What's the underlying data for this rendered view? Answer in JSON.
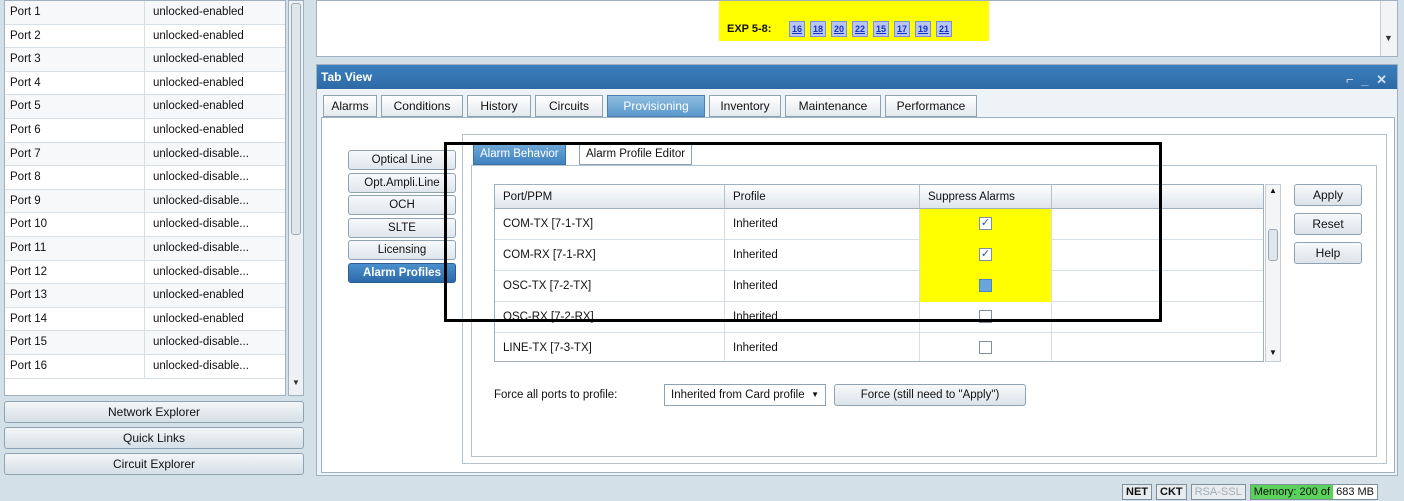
{
  "ports": [
    {
      "name": "Port 1",
      "state": "unlocked-enabled"
    },
    {
      "name": "Port 2",
      "state": "unlocked-enabled"
    },
    {
      "name": "Port 3",
      "state": "unlocked-enabled"
    },
    {
      "name": "Port 4",
      "state": "unlocked-enabled"
    },
    {
      "name": "Port 5",
      "state": "unlocked-enabled"
    },
    {
      "name": "Port 6",
      "state": "unlocked-enabled"
    },
    {
      "name": "Port 7",
      "state": "unlocked-disable..."
    },
    {
      "name": "Port 8",
      "state": "unlocked-disable..."
    },
    {
      "name": "Port 9",
      "state": "unlocked-disable..."
    },
    {
      "name": "Port 10",
      "state": "unlocked-disable..."
    },
    {
      "name": "Port 11",
      "state": "unlocked-disable..."
    },
    {
      "name": "Port 12",
      "state": "unlocked-disable..."
    },
    {
      "name": "Port 13",
      "state": "unlocked-enabled"
    },
    {
      "name": "Port 14",
      "state": "unlocked-enabled"
    },
    {
      "name": "Port 15",
      "state": "unlocked-disable..."
    },
    {
      "name": "Port 16",
      "state": "unlocked-disable..."
    }
  ],
  "explorers": {
    "network": "Network Explorer",
    "quick_links": "Quick Links",
    "circuit": "Circuit Explorer"
  },
  "exp": {
    "label": "EXP 5-8:",
    "numbers": [
      "16",
      "18",
      "20",
      "22",
      "15",
      "17",
      "19",
      "21"
    ]
  },
  "tab_view": {
    "title": "Tab View",
    "window_controls": "⌐ _ ✕",
    "tabs": [
      "Alarms",
      "Conditions",
      "History",
      "Circuits",
      "Provisioning",
      "Inventory",
      "Maintenance",
      "Performance"
    ],
    "active_tab": "Provisioning"
  },
  "side_buttons": [
    "Optical Line",
    "Opt.Ampli.Line",
    "OCH",
    "SLTE",
    "Licensing",
    "Alarm Profiles"
  ],
  "sub_tabs": [
    "Alarm Behavior",
    "Alarm Profile Editor"
  ],
  "alarm_table": {
    "headers": [
      "Port/PPM",
      "Profile",
      "Suppress Alarms"
    ],
    "rows": [
      {
        "port": "COM-TX [7-1-TX]",
        "profile": "Inherited",
        "suppress": "checked",
        "highlight": true
      },
      {
        "port": "COM-RX [7-1-RX]",
        "profile": "Inherited",
        "suppress": "checked",
        "highlight": true
      },
      {
        "port": "OSC-TX [7-2-TX]",
        "profile": "Inherited",
        "suppress": "indeterminate",
        "highlight": true
      },
      {
        "port": "OSC-RX [7-2-RX]",
        "profile": "Inherited",
        "suppress": "unchecked",
        "highlight": false
      },
      {
        "port": "LINE-TX [7-3-TX]",
        "profile": "Inherited",
        "suppress": "unchecked",
        "highlight": false
      }
    ]
  },
  "buttons": {
    "apply": "Apply",
    "reset": "Reset",
    "help": "Help"
  },
  "force": {
    "label": "Force all ports to profile:",
    "select_value": "Inherited from Card profile",
    "button": "Force (still need to \"Apply\")"
  },
  "status": {
    "net": "NET",
    "ckt": "CKT",
    "rsa": "RSA-SSL",
    "memory_used": "Memory: 200 of",
    "memory_total": "683 MB",
    "memory_fraction": 0.29
  },
  "colors": {
    "highlight_yellow": "#ffff00",
    "title_blue": "#3b7fbe",
    "memory_green": "#5bd15b"
  }
}
